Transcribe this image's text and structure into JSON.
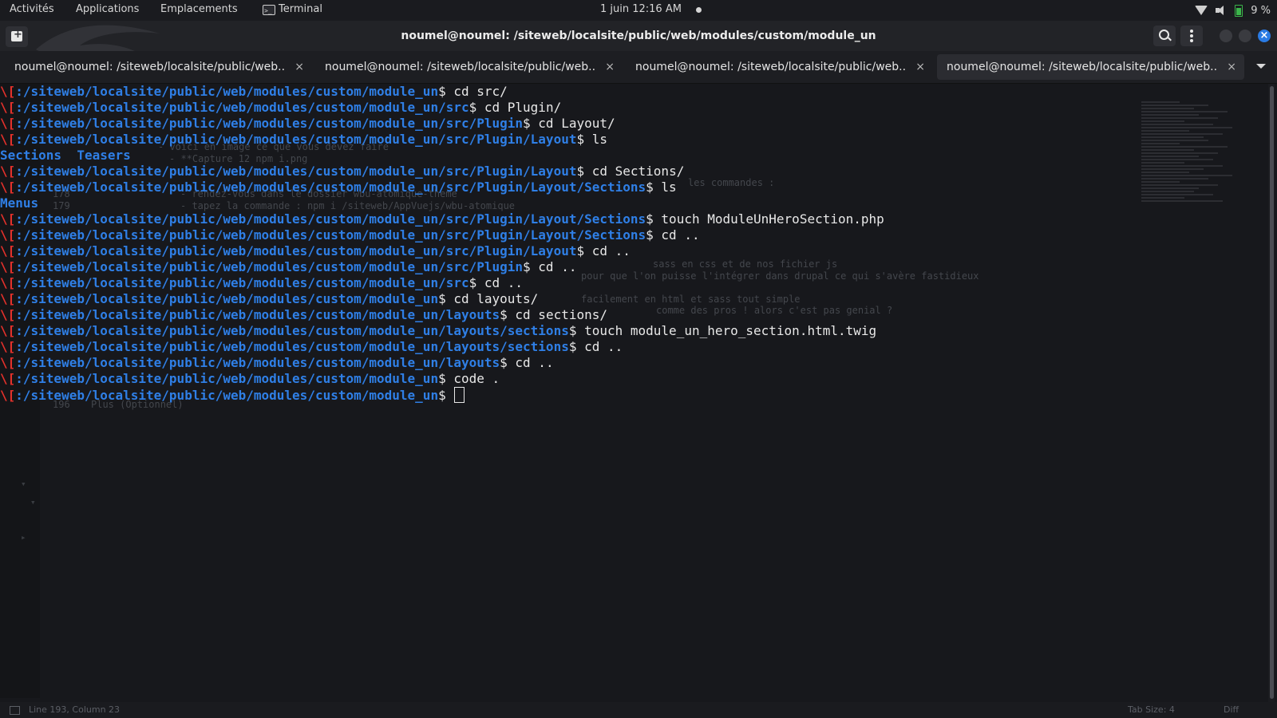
{
  "topbar": {
    "activities": "Activités",
    "applications": "Applications",
    "places": "Emplacements",
    "app_name": "Terminal",
    "clock": "1 juin  12:16 AM",
    "battery": "9 %",
    "icons": [
      "wifi-icon",
      "volume-icon",
      "battery-icon"
    ]
  },
  "window": {
    "title": "noumel@noumel: /siteweb/localsite/public/web/modules/custom/module_un"
  },
  "tabs": [
    {
      "label": "noumel@noumel: /siteweb/localsite/public/web...",
      "close": "×",
      "active": false
    },
    {
      "label": "noumel@noumel: /siteweb/localsite/public/web...",
      "close": "×",
      "active": false
    },
    {
      "label": "noumel@noumel: /siteweb/localsite/public/web...",
      "close": "×",
      "active": false
    },
    {
      "label": "noumel@noumel: /siteweb/localsite/public/web...",
      "close": "×",
      "active": true
    }
  ],
  "terminal": {
    "prompt_mark": "\\[",
    "lines": [
      {
        "path": ":/siteweb/localsite/public/web/modules/custom/module_un",
        "cmd": "$ cd src/"
      },
      {
        "path": ":/siteweb/localsite/public/web/modules/custom/module_un/src",
        "cmd": "$ cd Plugin/"
      },
      {
        "path": ":/siteweb/localsite/public/web/modules/custom/module_un/src/Plugin",
        "cmd": "$ cd Layout/"
      },
      {
        "path": ":/siteweb/localsite/public/web/modules/custom/module_un/src/Plugin/Layout",
        "cmd": "$ ls"
      },
      {
        "output": "Sections  Teasers"
      },
      {
        "path": ":/siteweb/localsite/public/web/modules/custom/module_un/src/Plugin/Layout",
        "cmd": "$ cd Sections/"
      },
      {
        "path": ":/siteweb/localsite/public/web/modules/custom/module_un/src/Plugin/Layout/Sections",
        "cmd": "$ ls"
      },
      {
        "output": "Menus"
      },
      {
        "path": ":/siteweb/localsite/public/web/modules/custom/module_un/src/Plugin/Layout/Sections",
        "cmd": "$ touch ModuleUnHeroSection.php"
      },
      {
        "path": ":/siteweb/localsite/public/web/modules/custom/module_un/src/Plugin/Layout/Sections",
        "cmd": "$ cd .."
      },
      {
        "path": ":/siteweb/localsite/public/web/modules/custom/module_un/src/Plugin/Layout",
        "cmd": "$ cd .."
      },
      {
        "path": ":/siteweb/localsite/public/web/modules/custom/module_un/src/Plugin",
        "cmd": "$ cd .."
      },
      {
        "path": ":/siteweb/localsite/public/web/modules/custom/module_un/src",
        "cmd": "$ cd .."
      },
      {
        "path": ":/siteweb/localsite/public/web/modules/custom/module_un",
        "cmd": "$ cd layouts/"
      },
      {
        "path": ":/siteweb/localsite/public/web/modules/custom/module_un/layouts",
        "cmd": "$ cd sections/"
      },
      {
        "path": ":/siteweb/localsite/public/web/modules/custom/module_un/layouts/sections",
        "cmd": "$ touch module_un_hero_section.html.twig"
      },
      {
        "path": ":/siteweb/localsite/public/web/modules/custom/module_un/layouts/sections",
        "cmd": "$ cd .."
      },
      {
        "path": ":/siteweb/localsite/public/web/modules/custom/module_un/layouts",
        "cmd": "$ cd .."
      },
      {
        "path": ":/siteweb/localsite/public/web/modules/custom/module_un",
        "cmd": "$ code ."
      },
      {
        "path": ":/siteweb/localsite/public/web/modules/custom/module_un",
        "cmd": "$ ",
        "cursor": true
      }
    ]
  },
  "ghost_editor": {
    "texts": [
      "- voici en image ce que vous devez faire",
      "- **Capture 12 npm i.png",
      "- rendez-vous dans le dossier wbu-atomique-theme",
      "- tapez la commande : npm i /siteweb/AppVuejs/wbu-atomique",
      "sass en css et de nos fichier js",
      "pour que l'on puisse l'intégrer dans drupal ce qui s'avère fastidieux",
      "facilement en html et sass tout simple",
      "comme des pros ! alors c'est pas genial ?",
      "les commandes :",
      "Plus (Optionnel)"
    ],
    "line_numbers": [
      "178",
      "179",
      "196"
    ],
    "status_left": "Line 193, Column 23",
    "status_tab": "Tab Size: 4",
    "status_diff": "Diff"
  },
  "colors": {
    "background": "#17181c",
    "path_blue": "#2f7fe6",
    "prompt_red": "#e4312b",
    "text": "#e8e8e8",
    "accent_close": "#2a7be4"
  }
}
